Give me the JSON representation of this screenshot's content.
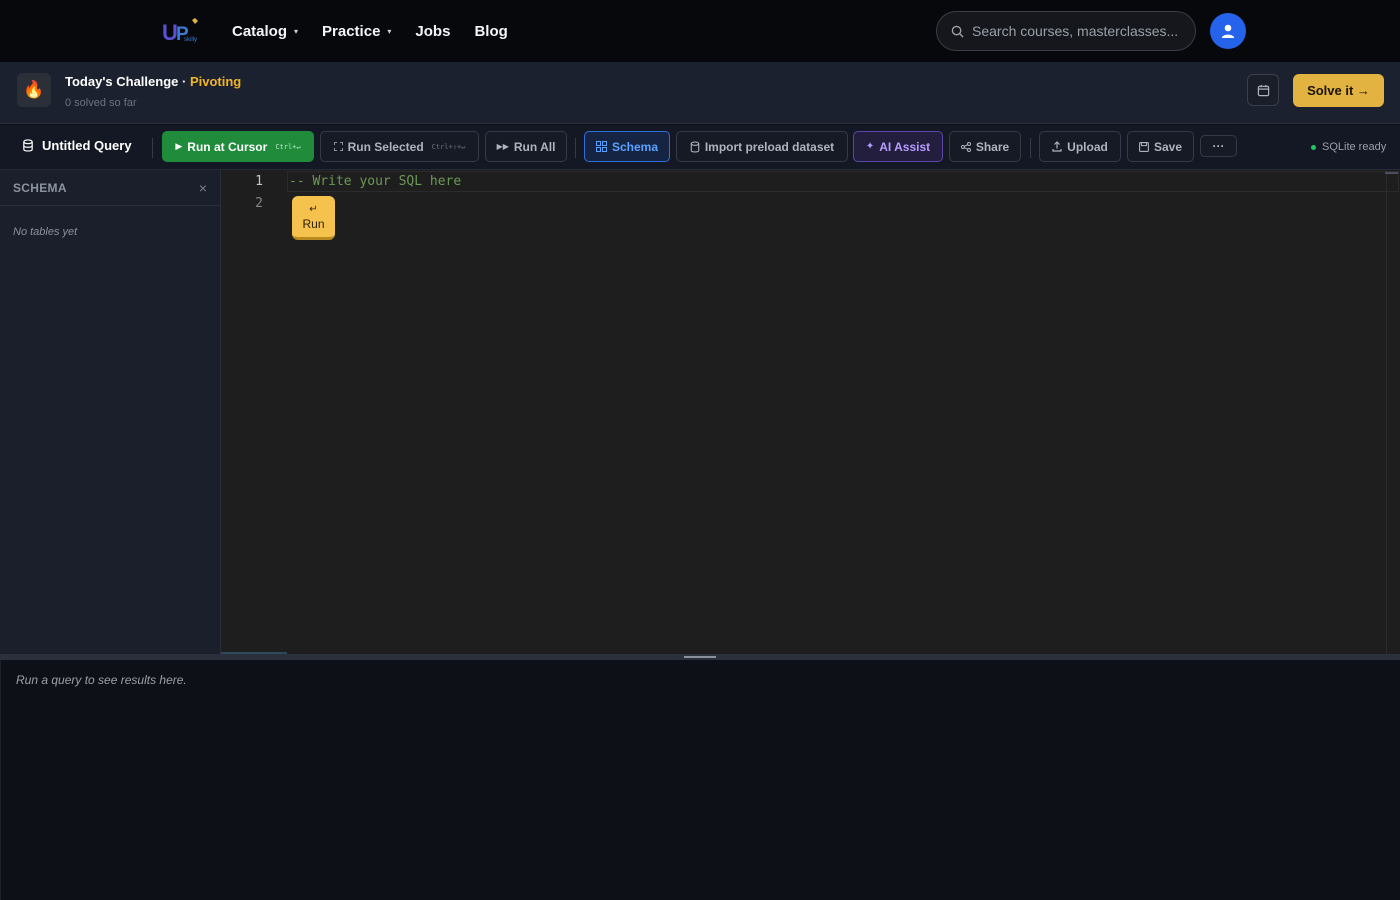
{
  "nav": {
    "logo_text": "UP",
    "links": [
      {
        "label": "Catalog",
        "dropdown": true
      },
      {
        "label": "Practice",
        "dropdown": true
      },
      {
        "label": "Jobs",
        "dropdown": false
      },
      {
        "label": "Blog",
        "dropdown": false
      }
    ],
    "search_placeholder": "Search courses, masterclasses...",
    "caret": "▾"
  },
  "challenge": {
    "title": "Today's Challenge",
    "separator": " · ",
    "topic": "Pivoting",
    "subtitle": "0 solved so far",
    "solve_label": "Solve it →"
  },
  "toolbar": {
    "query_title": "Untitled Query",
    "run_cursor": {
      "label": "Run at Cursor",
      "shortcut": "Ctrl+↵"
    },
    "run_selected": {
      "label": "Run Selected",
      "shortcut": "Ctrl+⇧+↵"
    },
    "run_all": "Run All",
    "schema": "Schema",
    "import": "Import preload dataset",
    "ai_assist": "AI Assist",
    "share": "Share",
    "upload": "Upload",
    "save": "Save",
    "more": "···",
    "status": "SQLite ready"
  },
  "schema_panel": {
    "title": "SCHEMA",
    "close": "×",
    "empty": "No tables yet"
  },
  "editor": {
    "line_numbers": [
      "1",
      "2"
    ],
    "line1": "-- Write your SQL here",
    "inline_run": {
      "key": "↵",
      "label": "Run"
    }
  },
  "results": {
    "empty": "Run a query to see results here."
  },
  "colors": {
    "accent_gold": "#e3b341",
    "run_green": "#1f8b3b",
    "schema_blue": "#5aa2ff",
    "ai_purple": "#b79cff",
    "avatar_blue": "#2563eb",
    "comment_green": "#6a9955"
  }
}
